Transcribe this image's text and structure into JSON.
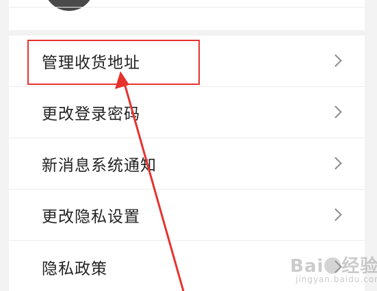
{
  "settings": {
    "items": [
      {
        "label": "管理收货地址",
        "icon": "chevron-right-icon"
      },
      {
        "label": "更改登录密码",
        "icon": "chevron-right-icon"
      },
      {
        "label": "新消息系统通知",
        "icon": "chevron-right-icon"
      },
      {
        "label": "更改隐私设置",
        "icon": "chevron-right-icon"
      },
      {
        "label": "隐私政策",
        "icon": "chevron-right-icon"
      }
    ]
  },
  "annotation": {
    "highlight_color": "#e5322d",
    "arrow_color": "#e5322d",
    "highlighted_item": "管理收货地址"
  },
  "watermark": {
    "brand_left": "Bai",
    "brand_right": "经验",
    "url": "jingyan.baidu.com"
  },
  "colors": {
    "background": "#ffffff",
    "frame": "#f3f3f3",
    "divider": "#ececec",
    "text": "#222222",
    "chevron": "#8c8c8c",
    "avatar": "#4a4a4a"
  }
}
